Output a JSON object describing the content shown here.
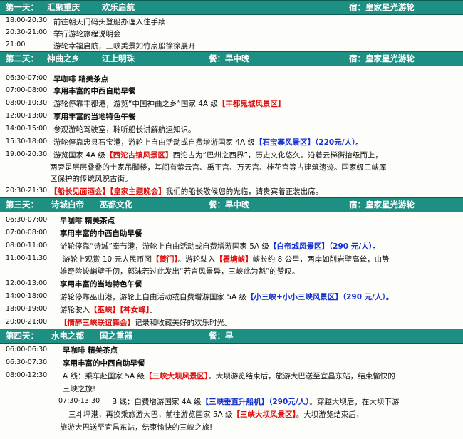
{
  "days": [
    {
      "header": {
        "day": "第一天：",
        "title1": "汇聚重庆",
        "title2": "欢乐启航",
        "meal": "",
        "stay": "宿：皇家星光游轮"
      },
      "rows": [
        {
          "time": "18:00-20:30",
          "lines": [
            [
              "前往朝天门码头登船办理入住手续"
            ]
          ]
        },
        {
          "time": "20:30-21:00",
          "lines": [
            [
              "举行游轮旅程说明会"
            ]
          ]
        },
        {
          "time": "21:00",
          "lines": [
            [
              "游轮幸福启航，三峡美景如竹扇般徐徐展开"
            ]
          ]
        }
      ]
    },
    {
      "header": {
        "day": "第二天：",
        "title1": "神曲之乡",
        "title2": "江上明珠",
        "meal": "餐：早中晚",
        "stay": "宿：皇家星光游轮"
      },
      "rows": [
        {
          "time": "06:30-07:00",
          "lines": [
            [
              "早咖啡 精美茶点"
            ]
          ]
        },
        {
          "time": "07:00-08:00",
          "lines": [
            [
              "享用丰富的中西自助早餐"
            ]
          ]
        },
        {
          "time": "08:00-10:30",
          "lines": [
            [
              "游轮停靠丰都港，游览“中国神曲之乡”国家 4A 级",
              "【丰都鬼城风景区】"
            ]
          ]
        },
        {
          "time": "12:00-13:00",
          "lines": [
            [
              "享用丰富的当地特色午餐"
            ]
          ]
        },
        {
          "time": "14:00-15:00",
          "lines": [
            [
              "参观游轮驾驶室，聆听船长讲解航运知识。"
            ]
          ]
        },
        {
          "time": "15:30-18:00",
          "lines": [
            [
              "游轮停靠忠县石宝港，游轮上自由活动或自费增游国家 4A 级",
              "【石宝寨风景区】",
              "（220元/人）。"
            ]
          ]
        },
        {
          "time": "19:00-20:30",
          "lines": [
            [
              "游览国家 4A 级",
              "【西沱古镇风景区】",
              "西沱古为“巴州之西界”，历史文化悠久。沿着云梯街拾级而上，"
            ],
            [
              "两旁是层层叠叠的土家吊脚楼，其间有紫云宫、禹王宫、万天宫、桂花宫等古建筑遗迹。国家级三峡库"
            ],
            [
              "区保护的传统风貌古街。"
            ]
          ]
        },
        {
          "time": "20:30-21:30",
          "lines": [
            [
              "【船长见面酒会】",
              "【皇家主题晚会】",
              "我们的船长敬候您的光临，请贵宾着正装出席。"
            ]
          ]
        }
      ]
    },
    {
      "header": {
        "day": "第三天：",
        "title1": "诗城白帝",
        "title2": "巫都文化",
        "meal": "餐：早中晚",
        "stay": "宿：皇家星光游轮"
      },
      "rows": [
        {
          "time": "06:30-07:00",
          "lines": [
            [
              "早咖啡 精美茶点"
            ]
          ]
        },
        {
          "time": "07:00-08:00",
          "lines": [
            [
              "享用丰富的中西自助早餐"
            ]
          ]
        },
        {
          "time": "08:00-11:00",
          "lines": [
            [
              "游轮停靠“诗城”奉节港，游轮上自由活动或自费增游国家 5A 级",
              "【白帝城风景区】",
              "（290 元/人）。"
            ]
          ]
        },
        {
          "time": "11:00-11:30",
          "lines": [
            [
              "游轮上观赏 10 元人民币图",
              "【夔门】",
              "。游轮驶入",
              "【瞿塘峡】",
              "峡长约 8 公里，两岸如削岩壁高耸，山势"
            ],
            [
              "雄奇险峻峭壁千仞，郭沫若过此发出“若言风景异，三峡此为魁”的赞叹。"
            ]
          ]
        },
        {
          "time": "12:00-13:00",
          "lines": [
            [
              "享用丰富的当地特色午餐"
            ]
          ]
        },
        {
          "time": "14:00-18:00",
          "lines": [
            [
              "游轮停靠巫山港，游轮上自由活动或自费增游国家 5A 级",
              "【小三峡+小小三峡风景区】",
              "（290 元/人）。"
            ]
          ]
        },
        {
          "time": "18:00-19:00",
          "lines": [
            [
              "游轮驶入",
              "【巫峡】",
              "【神女峰】",
              "。"
            ]
          ]
        },
        {
          "time": "20:00-21:00",
          "lines": [
            [
              "【情醉三峡联谊舞会】",
              "记录和收藏美好的欢乐时光。"
            ]
          ]
        }
      ]
    },
    {
      "header": {
        "day": "第四天：",
        "title1": "水电之都",
        "title2": "国之重器",
        "meal": "餐：早",
        "stay": ""
      },
      "rows": [
        {
          "time": "06:00-06:30",
          "lines": [
            [
              "早咖啡 精美茶点"
            ]
          ]
        },
        {
          "time": "06:30-07:30",
          "lines": [
            [
              "享用丰富的中西自助早餐"
            ]
          ]
        },
        {
          "time": "08:00-12:30",
          "lines": [
            [
              "A 线：乘车赴国家 5A 级",
              "【三峡大坝风景区】",
              "。大坝游览结束后，旅游大巴送至宜昌东站，结束愉快的"
            ],
            [
              "三峡之旅!"
            ]
          ]
        },
        {
          "time": "07:30-13:30",
          "lines": [
            [
              "B 线：自费增游国家 4A 级",
              "【三峡垂直升船机】",
              "（290元/人）",
              "。穿越大坝后，在大坝下游"
            ],
            [
              "三斗坪港，再换乘旅游大巴，前往游览国家 5A 级",
              "【三峡大坝风景区】",
              "。大坝游览结束后，"
            ],
            [
              "旅游大巴送至宜昌东站，结束愉快的三峡之旅!"
            ]
          ]
        }
      ]
    }
  ]
}
